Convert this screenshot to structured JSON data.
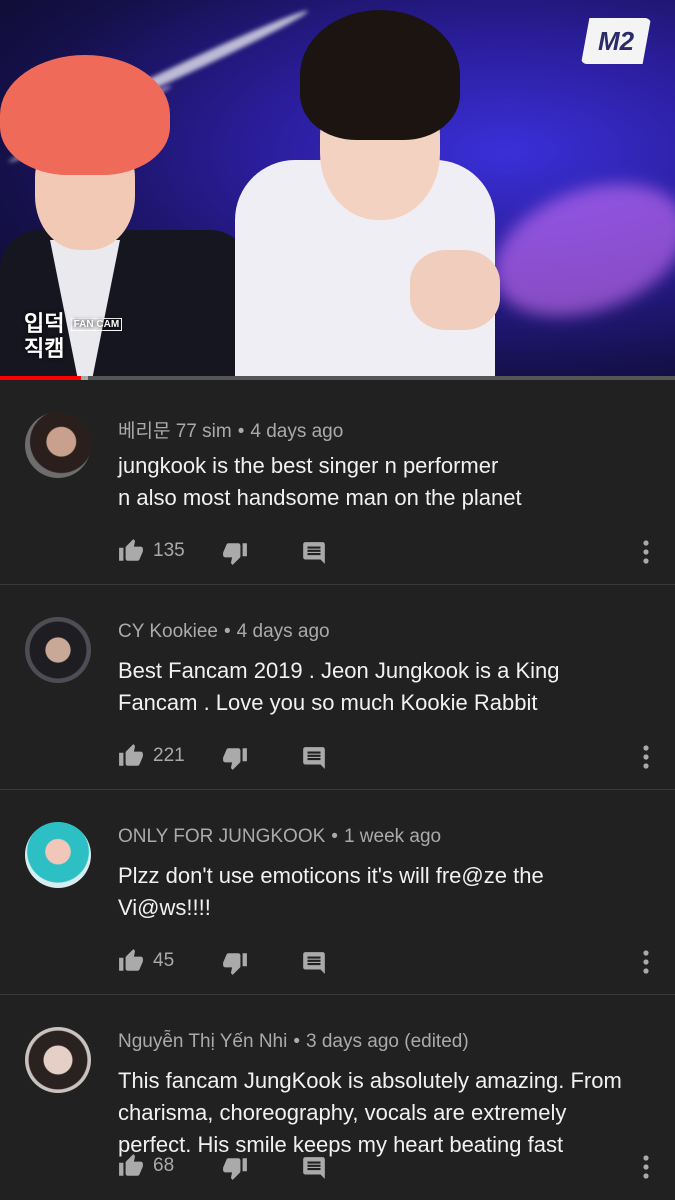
{
  "video": {
    "channel_logo_text": "M2",
    "overlay_tag_line1": "입덕",
    "overlay_tag_small": "FAN CAM",
    "overlay_tag_line2": "직캠",
    "progress_fraction": 0.12,
    "buffer_fraction": 0.01
  },
  "colors": {
    "background": "#212121",
    "meta_text": "#aaaaaa",
    "progress": "#ff0000",
    "divider": "#3a3a3a"
  },
  "comments": [
    {
      "author": "베리문 77 sim",
      "time": "4 days ago",
      "lines": [
        "jungkook  is the  best singer n performer",
        "n also  most handsome man  on the planet"
      ],
      "likes": "135"
    },
    {
      "author": "CY Kookiee",
      "time": "4 days ago",
      "lines": [
        "Best Fancam 2019 . Jeon Jungkook is a King",
        "Fancam . Love you so much Kookie Rabbit"
      ],
      "likes": "221"
    },
    {
      "author": "ONLY FOR JUNGKOOK",
      "time": "1 week ago",
      "lines": [
        "Plzz don't use emoticons it's will fre@ze the",
        "Vi@ws!!!!"
      ],
      "likes": "45"
    },
    {
      "author": "Nguyễn Thị Yến Nhi",
      "time": "3 days ago (edited)",
      "lines": [
        "This fancam JungKook is absolutely amazing. From",
        "charisma, choreography, vocals are extremely",
        "perfect. His smile keeps my heart beating fast"
      ],
      "likes": "68"
    }
  ]
}
